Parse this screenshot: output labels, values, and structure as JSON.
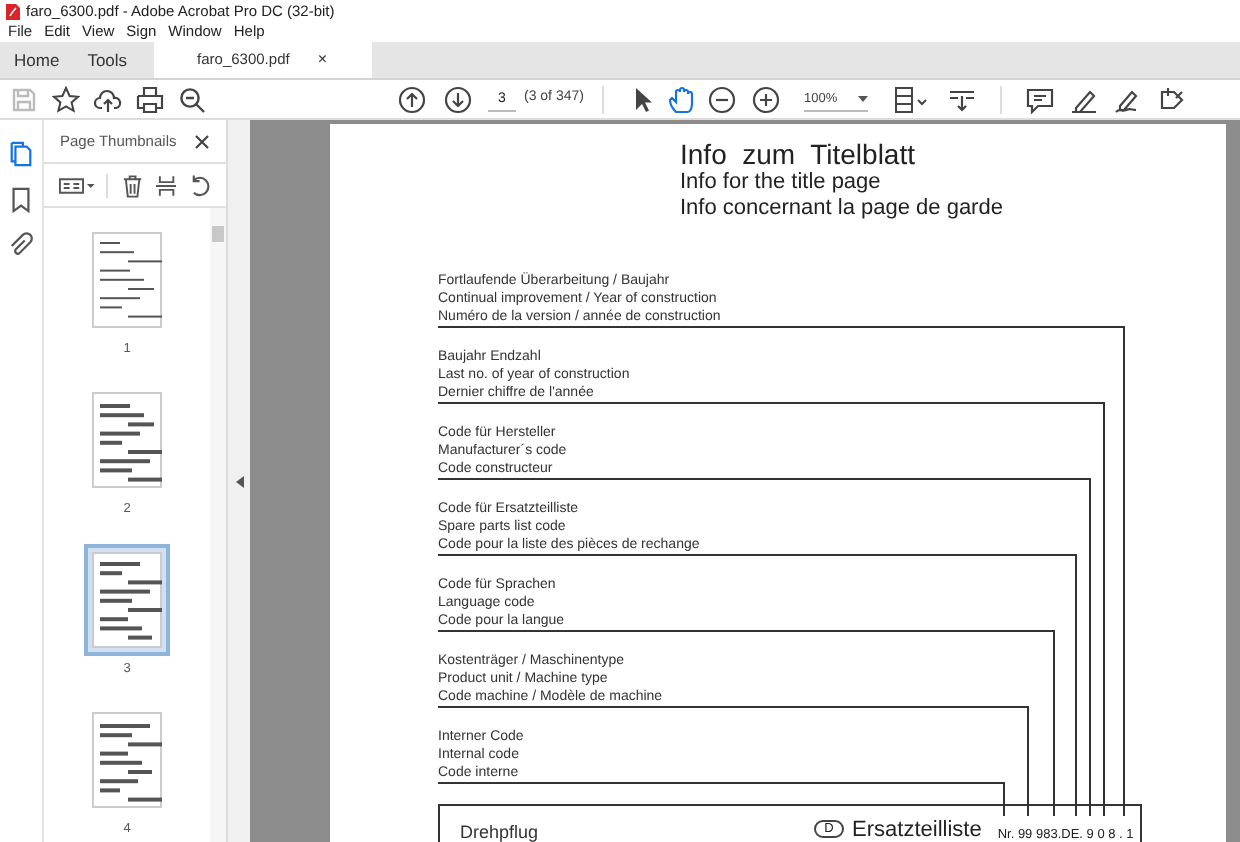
{
  "window": {
    "title": "faro_6300.pdf - Adobe Acrobat Pro DC (32-bit)"
  },
  "menu": [
    "File",
    "Edit",
    "View",
    "Sign",
    "Window",
    "Help"
  ],
  "tabs": [
    {
      "label": "Home",
      "selected": false
    },
    {
      "label": "Tools",
      "selected": false
    },
    {
      "label": "faro_6300.pdf",
      "selected": true,
      "close": "×"
    }
  ],
  "toolbar": {
    "save_disabled": true,
    "page_field": {
      "value": "3"
    },
    "page_count": "(3 of 347)",
    "zoom": "100%",
    "tools": [
      {
        "kind": "pointer",
        "selected": false
      },
      {
        "kind": "hand",
        "selected": true
      }
    ]
  },
  "side_rail": [
    {
      "kind": "pages",
      "selected": true
    },
    {
      "kind": "bookmarks",
      "selected": false
    },
    {
      "kind": "attachments",
      "selected": false
    }
  ],
  "panel": {
    "title": "Page Thumbnails",
    "thumbnails": [
      {
        "label": "1",
        "selected": false
      },
      {
        "label": "2",
        "selected": false
      },
      {
        "label": "3",
        "selected": true
      },
      {
        "label": "4",
        "selected": false
      }
    ]
  },
  "document": {
    "title": "Info  zum  Titelblatt",
    "subtitles": [
      "Info for the title page",
      "Info concernant la page de garde"
    ],
    "sections": [
      {
        "lines": [
          "Fortlaufende Überarbeitung / Baujahr",
          "Continual improvement / Year of construction",
          "Numéro de la version / année de construction"
        ]
      },
      {
        "lines": [
          "Baujahr Endzahl",
          "Last no. of year of construction",
          "Dernier chiffre de l'année"
        ]
      },
      {
        "lines": [
          "Code für Hersteller",
          "Manufacturer´s  code",
          "Code constructeur"
        ]
      },
      {
        "lines": [
          "Code für Ersatzteilliste",
          "Spare parts list code",
          "Code pour la liste des pièces de rechange"
        ]
      },
      {
        "lines": [
          "Code für Sprachen",
          "Language code",
          "Code pour la langue"
        ]
      },
      {
        "lines": [
          "Kostenträger / Maschinentype",
          "Product unit / Machine type",
          "Code machine / Modèle de machine"
        ]
      },
      {
        "lines": [
          "Interner Code",
          "Internal code",
          "Code interne"
        ]
      }
    ],
    "footer": {
      "machine": "Drehpflug",
      "language_mark": "D",
      "list_title": "Ersatzteilliste",
      "number": "Nr. 99 983.DE. 9 0 8 . 1"
    }
  }
}
